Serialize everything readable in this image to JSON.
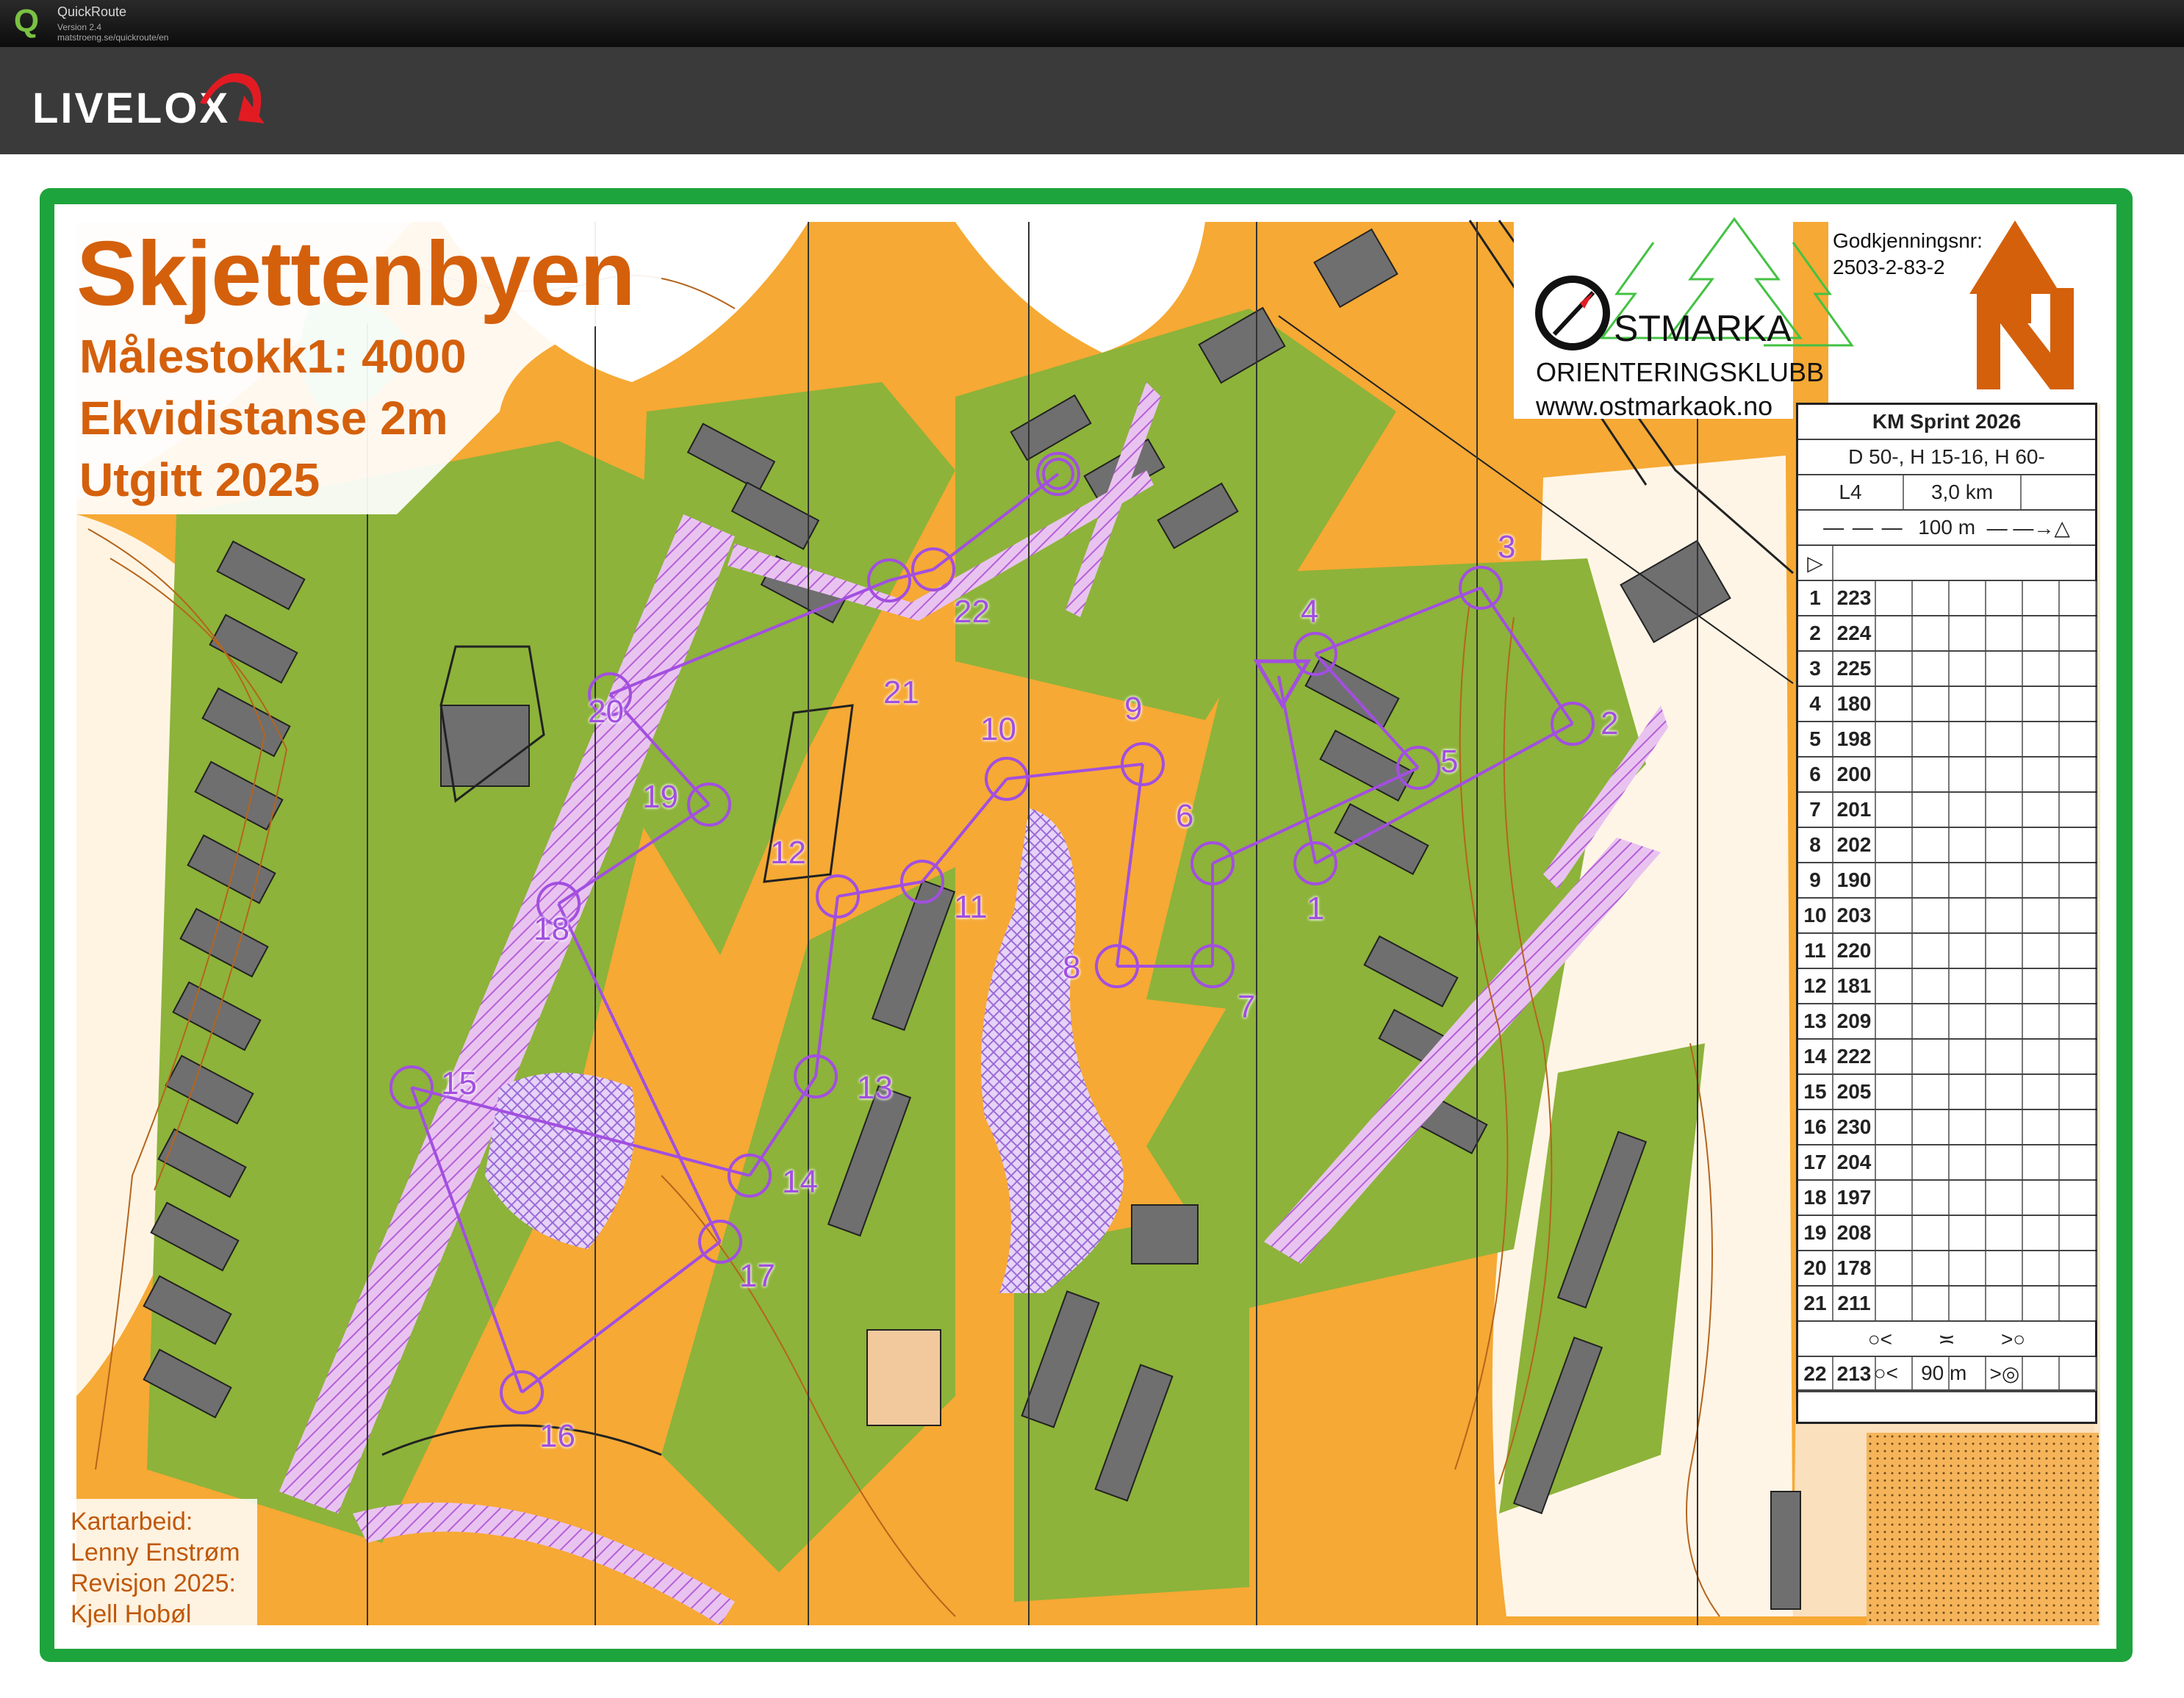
{
  "app": {
    "name": "QuickRoute",
    "version": "Version 2.4",
    "url": "matstroeng.se/quickroute/en"
  },
  "header": {
    "logo": "LIVELOX"
  },
  "map": {
    "title": "Skjettenbyen",
    "scale": "Målestokk1: 4000",
    "contour": "Ekvidistanse 2m",
    "published": "Utgitt 2025",
    "credits": [
      "Kartarbeid:",
      "Lenny Enstrøm",
      "Revisjon 2025:",
      "Kjell Hobøl"
    ],
    "club_name": "STMARKA",
    "club_sub": "ORIENTERINGSKLUBB",
    "club_web": "www.ostmarkaok.no",
    "approval_label": "Godkjenningsnr:",
    "approval_number": "2503-2-83-2",
    "controls": [
      {
        "label": "1"
      },
      {
        "label": "2"
      },
      {
        "label": "3"
      },
      {
        "label": "4"
      },
      {
        "label": "5"
      },
      {
        "label": "6"
      },
      {
        "label": "7"
      },
      {
        "label": "8"
      },
      {
        "label": "9"
      },
      {
        "label": "10"
      },
      {
        "label": "11"
      },
      {
        "label": "12"
      },
      {
        "label": "13"
      },
      {
        "label": "14"
      },
      {
        "label": "15"
      },
      {
        "label": "16"
      },
      {
        "label": "17"
      },
      {
        "label": "18"
      },
      {
        "label": "19"
      },
      {
        "label": "20"
      },
      {
        "label": "21"
      },
      {
        "label": "22"
      }
    ]
  },
  "description_sheet": {
    "event": "KM Sprint 2026",
    "classes": "D 50-, H 15-16, H 60-",
    "course": "L4",
    "length": "3,0 km",
    "marked_route": "100 m",
    "finish_distance": "90 m",
    "rows": [
      {
        "num": "1",
        "code": "223"
      },
      {
        "num": "2",
        "code": "224"
      },
      {
        "num": "3",
        "code": "225"
      },
      {
        "num": "4",
        "code": "180"
      },
      {
        "num": "5",
        "code": "198"
      },
      {
        "num": "6",
        "code": "200"
      },
      {
        "num": "7",
        "code": "201"
      },
      {
        "num": "8",
        "code": "202"
      },
      {
        "num": "9",
        "code": "190"
      },
      {
        "num": "10",
        "code": "203"
      },
      {
        "num": "11",
        "code": "220"
      },
      {
        "num": "12",
        "code": "181"
      },
      {
        "num": "13",
        "code": "209"
      },
      {
        "num": "14",
        "code": "222"
      },
      {
        "num": "15",
        "code": "205"
      },
      {
        "num": "16",
        "code": "230"
      },
      {
        "num": "17",
        "code": "204"
      },
      {
        "num": "18",
        "code": "197"
      },
      {
        "num": "19",
        "code": "208"
      },
      {
        "num": "20",
        "code": "178"
      },
      {
        "num": "21",
        "code": "211"
      },
      {
        "num": "22",
        "code": "213"
      }
    ]
  },
  "colors": {
    "route": "#a24fe0",
    "frame": "#1ea43c",
    "title": "#d4600c",
    "open_land": "#f5a623",
    "green": "#8db33a",
    "building": "#6f6f6f"
  }
}
